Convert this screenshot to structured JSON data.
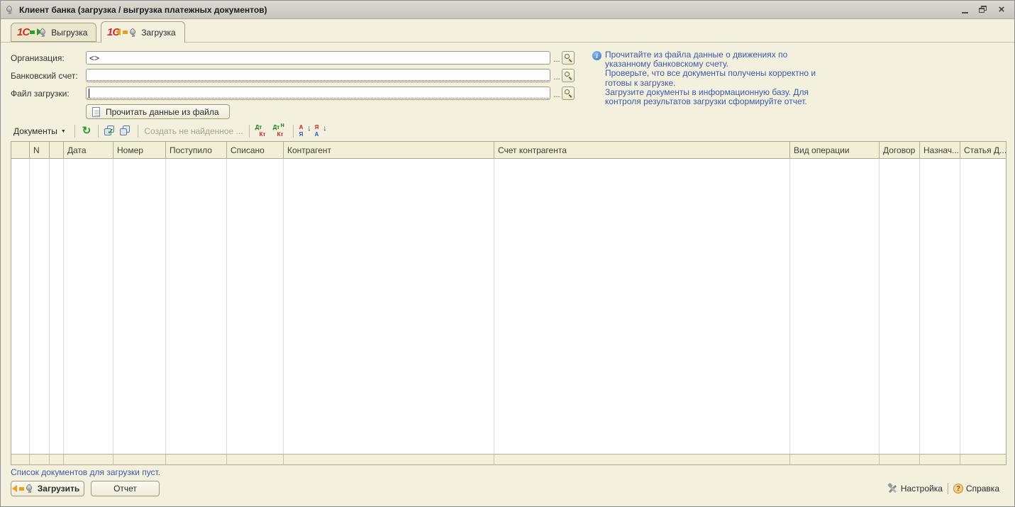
{
  "window": {
    "title": "Клиент банка (загрузка / выгрузка платежных документов)"
  },
  "icons": {
    "logo_1c": "1С",
    "close": "×",
    "refresh": "↻",
    "check": "✓",
    "dropdown_arrow": "▼",
    "ellipsis": "...",
    "info": "i",
    "question": "?",
    "dt": "Дт",
    "kt": "Кт",
    "n_sup": "Н",
    "letter_a": "А",
    "letter_ya": "Я",
    "arrow_down": "↓"
  },
  "tabs": [
    {
      "label": "Выгрузка",
      "active": false
    },
    {
      "label": "Загрузка",
      "active": true
    }
  ],
  "form": {
    "fields": [
      {
        "label": "Организация:",
        "value": "<>"
      },
      {
        "label": "Банковский счет:",
        "value": ""
      },
      {
        "label": "Файл загрузки:",
        "value": ""
      }
    ],
    "read_button_label": "Прочитать данные из файла"
  },
  "help": {
    "text": "Прочитайте из файла данные о движениях по\nуказанному банковскому счету.\nПроверьте, что все  документы получены корректно и\nготовы к загрузке.\nЗагрузите документы в информационную базу. Для\nконтроля результатов загрузки сформируйте отчет."
  },
  "toolbar": {
    "documents_label": "Документы",
    "create_not_found_label": "Создать не найденное ..."
  },
  "table": {
    "columns": [
      "",
      "N",
      "",
      "Дата",
      "Номер",
      "Поступило",
      "Списано",
      "Контрагент",
      "Счет контрагента",
      "Вид операции",
      "Договор",
      "Назнач...",
      "Статья Д..."
    ]
  },
  "status": {
    "empty_list_text": "Список документов для загрузки пуст."
  },
  "footer": {
    "load_button_label": "Загрузить",
    "report_button_label": "Отчет",
    "settings_label": "Настройка",
    "help_label": "Справка"
  },
  "colors": {
    "window_bg": "#f3f0dd",
    "titlebar_bg": "#d3d0c9",
    "table_header_bg": "#f2eed8",
    "blue_text": "#3b5bab",
    "accent_red": "#d22f2f",
    "accent_green": "#2e9b2e",
    "accent_orange": "#e8a020"
  }
}
